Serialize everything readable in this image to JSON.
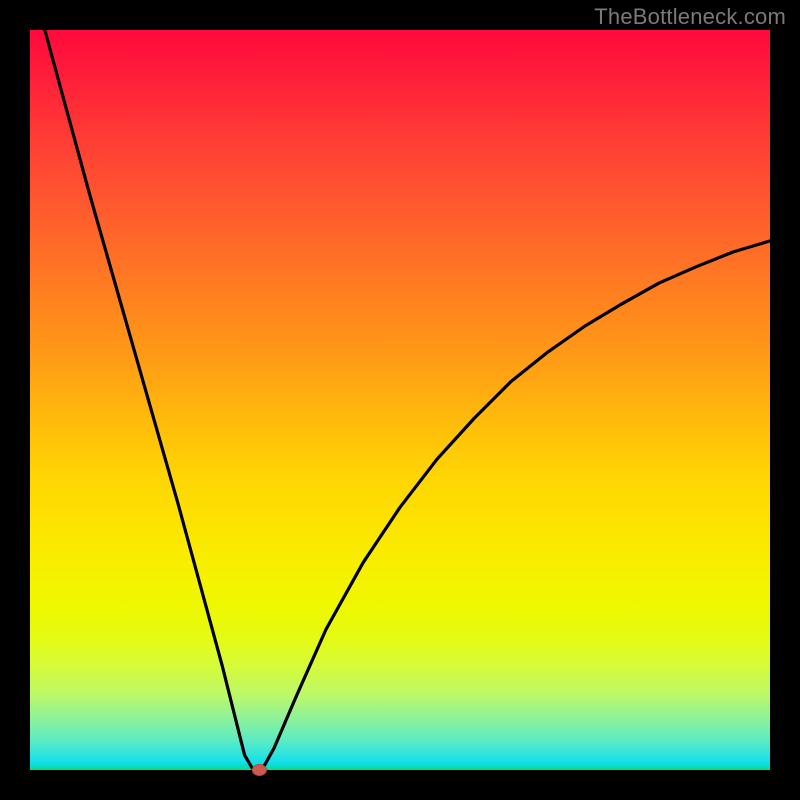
{
  "watermark": "TheBottleneck.com",
  "chart_data": {
    "type": "line",
    "title": "",
    "xlabel": "",
    "ylabel": "",
    "xlim": [
      0,
      100
    ],
    "ylim": [
      0,
      100
    ],
    "x": [
      2,
      5,
      8,
      11,
      14,
      17,
      20,
      23,
      26,
      28,
      29,
      30,
      30.5,
      31,
      31.5,
      33,
      36,
      40,
      45,
      50,
      55,
      60,
      65,
      70,
      75,
      80,
      85,
      90,
      95,
      100
    ],
    "y": [
      100,
      89,
      78,
      67.5,
      57,
      46.5,
      36,
      25,
      14,
      6,
      2,
      0.3,
      0,
      0,
      0.3,
      3,
      10,
      19,
      28,
      35.5,
      42,
      47.5,
      52.5,
      56.5,
      60,
      63,
      65.8,
      68,
      70,
      71.5
    ],
    "marker": {
      "x": 31,
      "y": 0
    },
    "colors": {
      "top": "#ff0a3c",
      "mid": "#ffd404",
      "bottom": "#00e07a",
      "line": "#000000",
      "marker": "#cc5a4d"
    }
  }
}
